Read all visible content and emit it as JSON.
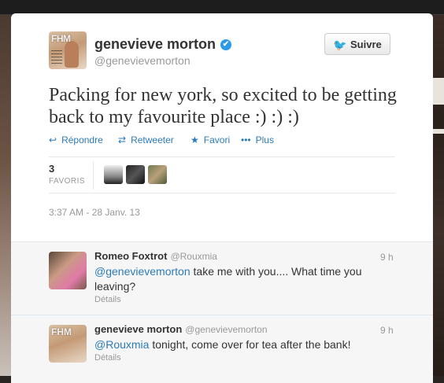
{
  "tweet": {
    "author_name": "genevieve morton",
    "author_handle": "@genevievemorton",
    "avatar_text": "FHM",
    "follow_label": "Suivre",
    "text": "Packing for new york, so excited to be getting back to my favourite place :) :) :)",
    "actions": {
      "reply": "Répondre",
      "retweet": "Retweeter",
      "favorite": "Favori",
      "more": "Plus"
    },
    "stats": {
      "count": "3",
      "label": "FAVORIS"
    },
    "timestamp": "3:37 AM - 28 Janv. 13"
  },
  "icons": {
    "verified": "✔",
    "bird": "🐦",
    "reply": "↩",
    "retweet": "⇄",
    "favorite": "★",
    "more": "•••"
  },
  "replies": [
    {
      "name": "Romeo Foxtrot",
      "handle": "@Rouxmia",
      "time": "9 h",
      "mention": "@genevievemorton",
      "text": " take me with you.... What time you leaving?",
      "details": "Détails"
    },
    {
      "name": "genevieve morton",
      "handle": "@genevievemorton",
      "time": "9 h",
      "avatar_text": "FHM",
      "mention": "@Rouxmia",
      "text": " tonight, come over for tea after the bank!",
      "details": "Détails"
    }
  ],
  "colors": {
    "link": "#2b7bb9",
    "verified": "#2b9ae9",
    "muted": "#999999"
  }
}
